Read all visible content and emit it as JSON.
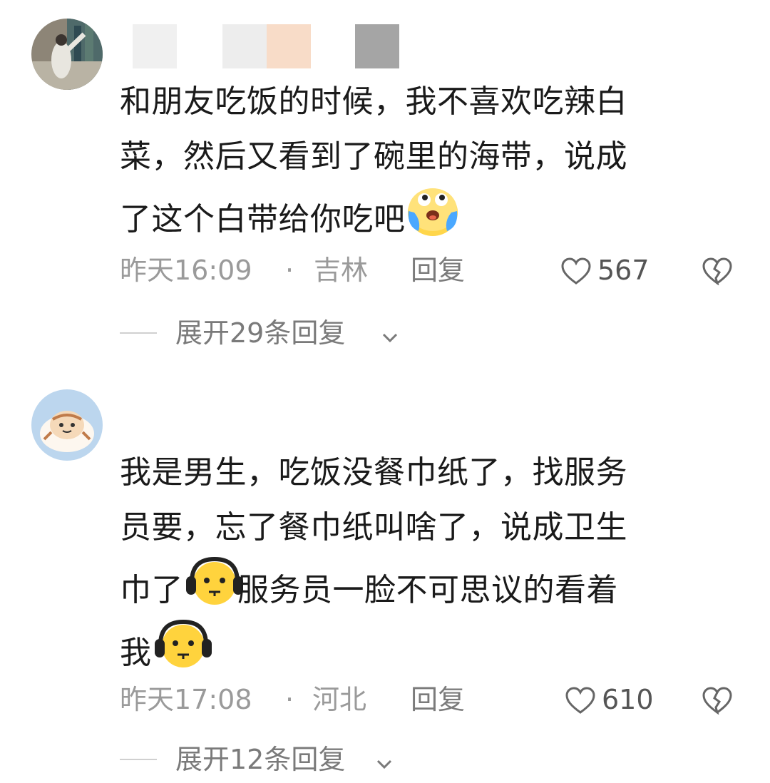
{
  "comments": [
    {
      "text_lines": [
        "和朋友吃饭的时候，我不喜欢吃辣白",
        "菜，然后又看到了碗里的海带，说成",
        "了这个白带给你吃吧"
      ],
      "time": "昨天16:09",
      "location": "吉林",
      "reply_label": "回复",
      "likes": "567",
      "expand_label": "展开29条回复",
      "emoji": "crying-laughing-emoji"
    },
    {
      "text_lines": [
        "我是男生，吃饭没餐巾纸了，找服务",
        "员要，忘了餐巾纸叫啥了，说成卫生",
        "巾了",
        "服务员一脸不可思议的看着",
        "我"
      ],
      "time": "昨天17:08",
      "location": "河北",
      "reply_label": "回复",
      "likes": "610",
      "expand_label": "展开12条回复",
      "emoji": "headphones-speechless-emoji"
    }
  ],
  "separator": "·",
  "icons": {
    "like": "heart-outline-icon",
    "dislike": "broken-heart-icon",
    "expand": "chevron-down-icon"
  }
}
